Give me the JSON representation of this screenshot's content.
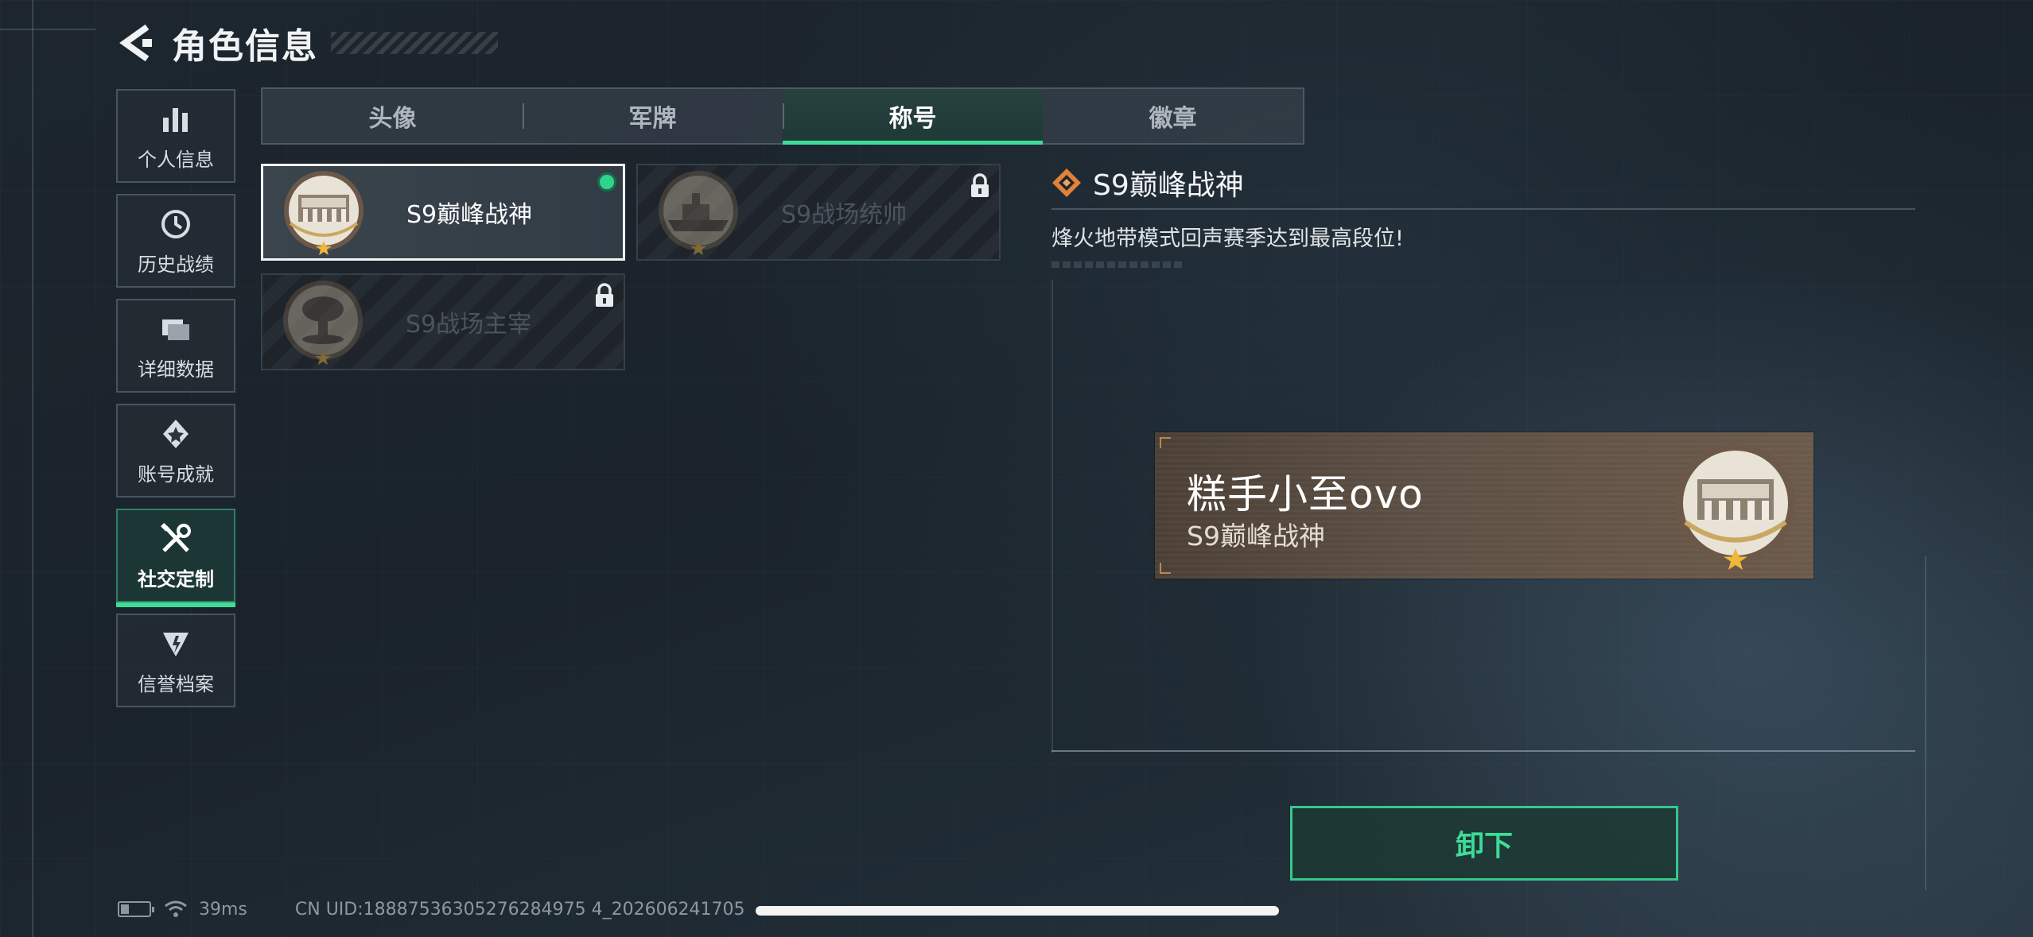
{
  "header": {
    "title": "角色信息",
    "back_icon": "back-arrow-icon"
  },
  "sidebar": {
    "items": [
      {
        "label": "个人信息",
        "icon": "bar-chart-icon",
        "active": false
      },
      {
        "label": "历史战绩",
        "icon": "clock-icon",
        "active": false
      },
      {
        "label": "详细数据",
        "icon": "folder-icon",
        "active": false
      },
      {
        "label": "账号成就",
        "icon": "medal-icon",
        "active": false
      },
      {
        "label": "社交定制",
        "icon": "tools-icon",
        "active": true
      },
      {
        "label": "信誉档案",
        "icon": "shield-badge-icon",
        "active": false
      }
    ]
  },
  "tabs": [
    {
      "label": "头像",
      "active": false
    },
    {
      "label": "军牌",
      "active": false
    },
    {
      "label": "称号",
      "active": true
    },
    {
      "label": "徽章",
      "active": false
    }
  ],
  "titles": [
    {
      "label": "S9巅峰战神",
      "selected": true,
      "locked": false,
      "equipped": true,
      "emblem": "monument-emblem-icon"
    },
    {
      "label": "S9战场统帅",
      "selected": false,
      "locked": true,
      "equipped": false,
      "emblem": "warship-emblem-icon"
    },
    {
      "label": "S9战场主宰",
      "selected": false,
      "locked": true,
      "equipped": false,
      "emblem": "mushroom-cloud-emblem-icon"
    }
  ],
  "detail": {
    "title": "S9巅峰战神",
    "description": "烽火地带模式回声赛季达到最高段位!",
    "icon": "diamond-rank-icon"
  },
  "nameplate": {
    "player_name": "糕手小至ovo",
    "title": "S9巅峰战神",
    "emblem": "monument-emblem-icon"
  },
  "actions": {
    "unequip_label": "卸下"
  },
  "footer": {
    "ping": "39ms",
    "uid": "CN UID:18887536305276284975 4_202606241705",
    "battery_level": 0.25
  },
  "colors": {
    "accent": "#3ddc97",
    "nameplate_bg": "#5e5044",
    "background": "#1d262e"
  }
}
